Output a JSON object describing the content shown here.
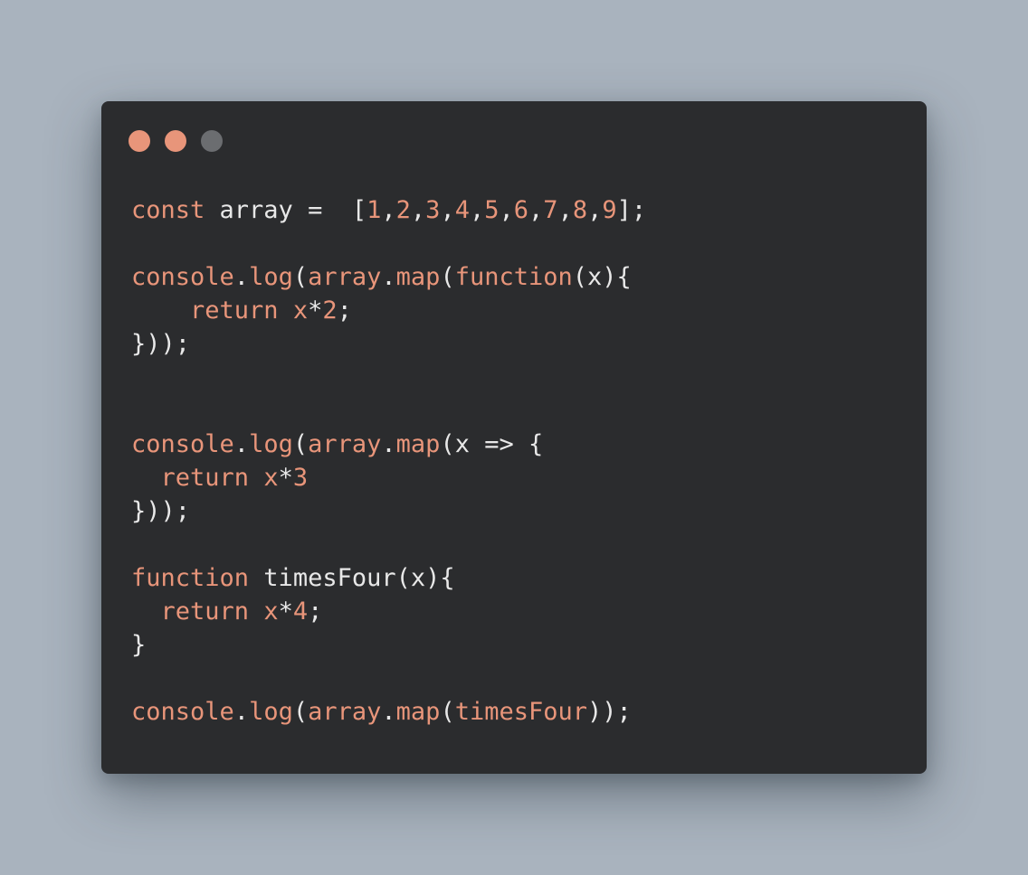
{
  "colors": {
    "background": "#a9b3be",
    "window": "#2b2c2e",
    "accent": "#e8957a",
    "text": "#e8e8e8",
    "dot_inactive": "#6b6d70"
  },
  "window_controls": [
    {
      "name": "close-dot",
      "color": "#e8957a"
    },
    {
      "name": "minimize-dot",
      "color": "#e8957a"
    },
    {
      "name": "maximize-dot",
      "color": "#6b6d70"
    }
  ],
  "code_lines": [
    [
      {
        "t": "kw",
        "v": "const"
      },
      {
        "t": "id",
        "v": " array =  "
      },
      {
        "t": "pn",
        "v": "["
      },
      {
        "t": "num",
        "v": "1"
      },
      {
        "t": "pn",
        "v": ","
      },
      {
        "t": "num",
        "v": "2"
      },
      {
        "t": "pn",
        "v": ","
      },
      {
        "t": "num",
        "v": "3"
      },
      {
        "t": "pn",
        "v": ","
      },
      {
        "t": "num",
        "v": "4"
      },
      {
        "t": "pn",
        "v": ","
      },
      {
        "t": "num",
        "v": "5"
      },
      {
        "t": "pn",
        "v": ","
      },
      {
        "t": "num",
        "v": "6"
      },
      {
        "t": "pn",
        "v": ","
      },
      {
        "t": "num",
        "v": "7"
      },
      {
        "t": "pn",
        "v": ","
      },
      {
        "t": "num",
        "v": "8"
      },
      {
        "t": "pn",
        "v": ","
      },
      {
        "t": "num",
        "v": "9"
      },
      {
        "t": "pn",
        "v": "];"
      }
    ],
    [],
    [
      {
        "t": "fn",
        "v": "console"
      },
      {
        "t": "pn",
        "v": "."
      },
      {
        "t": "fn",
        "v": "log"
      },
      {
        "t": "pn",
        "v": "("
      },
      {
        "t": "fn",
        "v": "array"
      },
      {
        "t": "pn",
        "v": "."
      },
      {
        "t": "fn",
        "v": "map"
      },
      {
        "t": "pn",
        "v": "("
      },
      {
        "t": "kw",
        "v": "function"
      },
      {
        "t": "pn",
        "v": "(x){"
      }
    ],
    [
      {
        "t": "kw",
        "v": "    return"
      },
      {
        "t": "id",
        "v": " "
      },
      {
        "t": "fn",
        "v": "x"
      },
      {
        "t": "pn",
        "v": "*"
      },
      {
        "t": "num",
        "v": "2"
      },
      {
        "t": "pn",
        "v": ";"
      }
    ],
    [
      {
        "t": "pn",
        "v": "}));"
      }
    ],
    [],
    [],
    [
      {
        "t": "fn",
        "v": "console"
      },
      {
        "t": "pn",
        "v": "."
      },
      {
        "t": "fn",
        "v": "log"
      },
      {
        "t": "pn",
        "v": "("
      },
      {
        "t": "fn",
        "v": "array"
      },
      {
        "t": "pn",
        "v": "."
      },
      {
        "t": "fn",
        "v": "map"
      },
      {
        "t": "pn",
        "v": "(x => {"
      }
    ],
    [
      {
        "t": "kw",
        "v": "  return"
      },
      {
        "t": "id",
        "v": " "
      },
      {
        "t": "fn",
        "v": "x"
      },
      {
        "t": "pn",
        "v": "*"
      },
      {
        "t": "num",
        "v": "3"
      }
    ],
    [
      {
        "t": "pn",
        "v": "}));"
      }
    ],
    [],
    [
      {
        "t": "kw",
        "v": "function"
      },
      {
        "t": "id",
        "v": " timesFour"
      },
      {
        "t": "pn",
        "v": "(x){"
      }
    ],
    [
      {
        "t": "kw",
        "v": "  return"
      },
      {
        "t": "id",
        "v": " "
      },
      {
        "t": "fn",
        "v": "x"
      },
      {
        "t": "pn",
        "v": "*"
      },
      {
        "t": "num",
        "v": "4"
      },
      {
        "t": "pn",
        "v": ";"
      }
    ],
    [
      {
        "t": "pn",
        "v": "}"
      }
    ],
    [],
    [
      {
        "t": "fn",
        "v": "console"
      },
      {
        "t": "pn",
        "v": "."
      },
      {
        "t": "fn",
        "v": "log"
      },
      {
        "t": "pn",
        "v": "("
      },
      {
        "t": "fn",
        "v": "array"
      },
      {
        "t": "pn",
        "v": "."
      },
      {
        "t": "fn",
        "v": "map"
      },
      {
        "t": "pn",
        "v": "("
      },
      {
        "t": "fn",
        "v": "timesFour"
      },
      {
        "t": "pn",
        "v": "));"
      }
    ]
  ]
}
